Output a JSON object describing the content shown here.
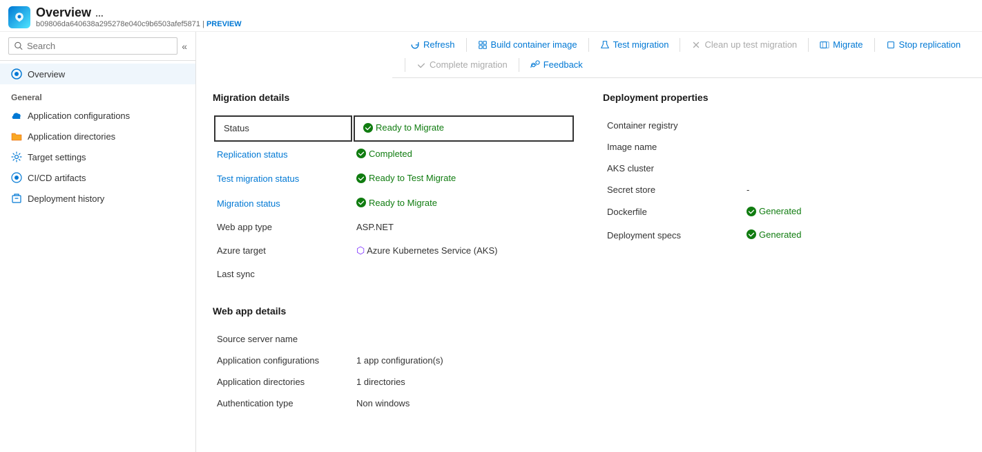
{
  "titleBar": {
    "appName": "Overview",
    "ellipsis": "...",
    "resourceId": "b09806da640638a295278e040c9b6503afef5871",
    "separator": "|",
    "preview": "PREVIEW"
  },
  "toolbar": {
    "refresh": "Refresh",
    "buildContainerImage": "Build container image",
    "testMigration": "Test migration",
    "cleanUpTestMigration": "Clean up test migration",
    "migrate": "Migrate",
    "stopReplication": "Stop replication",
    "completeMigration": "Complete migration",
    "feedback": "Feedback"
  },
  "sidebar": {
    "searchPlaceholder": "Search",
    "overview": "Overview",
    "generalLabel": "General",
    "items": [
      {
        "label": "Application configurations",
        "icon": "cloud"
      },
      {
        "label": "Application directories",
        "icon": "folder"
      },
      {
        "label": "Target settings",
        "icon": "gear"
      },
      {
        "label": "CI/CD artifacts",
        "icon": "cloud2"
      },
      {
        "label": "Deployment history",
        "icon": "box"
      }
    ]
  },
  "migrationDetails": {
    "sectionTitle": "Migration details",
    "rows": [
      {
        "label": "Status",
        "value": "Ready to Migrate",
        "type": "badge-green",
        "link": false,
        "highlighted": true
      },
      {
        "label": "Replication status",
        "value": "Completed",
        "type": "badge-green",
        "link": true
      },
      {
        "label": "Test migration status",
        "value": "Ready to Test Migrate",
        "type": "badge-green",
        "link": true
      },
      {
        "label": "Migration status",
        "value": "Ready to Migrate",
        "type": "badge-green",
        "link": true
      },
      {
        "label": "Web app type",
        "value": "ASP.NET",
        "type": "text",
        "link": false
      },
      {
        "label": "Azure target",
        "value": "Azure Kubernetes Service (AKS)",
        "type": "aks",
        "link": false
      },
      {
        "label": "Last sync",
        "value": "",
        "type": "text",
        "link": false
      }
    ]
  },
  "deploymentProperties": {
    "sectionTitle": "Deployment properties",
    "rows": [
      {
        "label": "Container registry",
        "value": "",
        "type": "text"
      },
      {
        "label": "Image name",
        "value": "",
        "type": "text"
      },
      {
        "label": "AKS cluster",
        "value": "",
        "type": "text"
      },
      {
        "label": "Secret store",
        "value": "-",
        "type": "text"
      },
      {
        "label": "Dockerfile",
        "value": "Generated",
        "type": "badge-green"
      },
      {
        "label": "Deployment specs",
        "value": "Generated",
        "type": "badge-green"
      }
    ]
  },
  "webAppDetails": {
    "sectionTitle": "Web app details",
    "rows": [
      {
        "label": "Source server name",
        "value": "",
        "type": "text"
      },
      {
        "label": "Application configurations",
        "value": "1 app configuration(s)",
        "type": "text"
      },
      {
        "label": "Application directories",
        "value": "1 directories",
        "type": "text"
      },
      {
        "label": "Authentication type",
        "value": "Non windows",
        "type": "text"
      }
    ]
  }
}
